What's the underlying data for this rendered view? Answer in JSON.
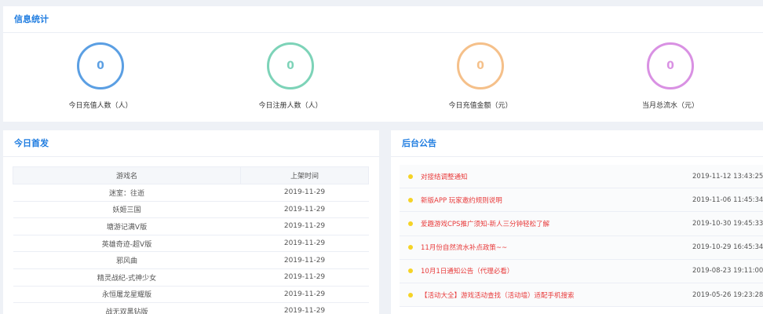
{
  "stats": {
    "title": "信息统计",
    "items": [
      {
        "value": "0",
        "label": "今日充值人数（人）",
        "color": "#5b9fe3"
      },
      {
        "value": "0",
        "label": "今日注册人数（人）",
        "color": "#7dd3b8"
      },
      {
        "value": "0",
        "label": "今日充值金额（元）",
        "color": "#f5c08a"
      },
      {
        "value": "0",
        "label": "当月总流水（元）",
        "color": "#d991e3"
      }
    ]
  },
  "games": {
    "title": "今日首发",
    "headers": [
      "游戏名",
      "上架时间"
    ],
    "rows": [
      [
        "迷室：往逝",
        "2019-11-29"
      ],
      [
        "妖姬三国",
        "2019-11-29"
      ],
      [
        "塘游记满V版",
        "2019-11-29"
      ],
      [
        "英雄奇迹-超V版",
        "2019-11-29"
      ],
      [
        "邪风曲",
        "2019-11-29"
      ],
      [
        "精灵战纪-式神少女",
        "2019-11-29"
      ],
      [
        "永恒屠龙星耀版",
        "2019-11-29"
      ],
      [
        "战无双黑钻版",
        "2019-11-29"
      ]
    ]
  },
  "notices": {
    "title": "后台公告",
    "items": [
      {
        "title": "对接结调整通知",
        "date": "2019-11-12 13:43:25"
      },
      {
        "title": "新版APP 玩家邀约规则说明",
        "date": "2019-11-06 11:45:34"
      },
      {
        "title": "爱趣游戏CPS推广须知-新人三分钟轻松了解",
        "date": "2019-10-30 19:45:33"
      },
      {
        "title": "11月份自然流水补点政策~~",
        "date": "2019-10-29 16:45:34"
      },
      {
        "title": "10月1日通知公告（代理必看）",
        "date": "2019-08-23 19:11:00"
      },
      {
        "title": "【活动大全】游戏活动查找（活动墙）适配手机搜索",
        "date": "2019-05-26 19:23:28"
      }
    ]
  }
}
